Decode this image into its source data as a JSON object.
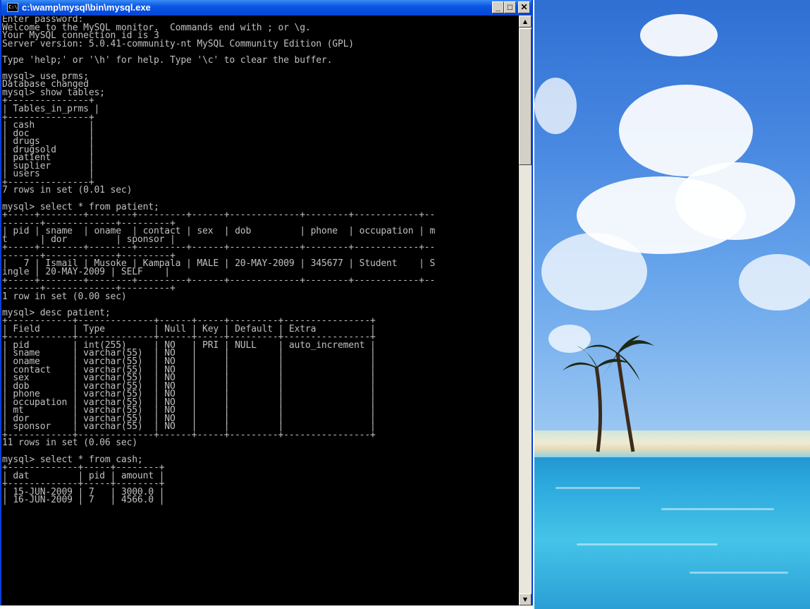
{
  "window": {
    "title": "c:\\wamp\\mysql\\bin\\mysql.exe",
    "icon_name": "console-icon",
    "icon_text": "C:\\",
    "buttons": {
      "minimize": "_",
      "maximize": "□",
      "close": "✕"
    }
  },
  "scrollbar": {
    "up_icon": "▲",
    "down_icon": "▼"
  },
  "console": {
    "lines": [
      "Enter password:",
      "Welcome to the MySQL monitor.  Commands end with ; or \\g.",
      "Your MySQL connection id is 3",
      "Server version: 5.0.41-community-nt MySQL Community Edition (GPL)",
      "",
      "Type 'help;' or '\\h' for help. Type '\\c' to clear the buffer.",
      "",
      "mysql> use prms;",
      "Database changed",
      "mysql> show tables;",
      "+---------------+",
      "| Tables_in_prms |",
      "+---------------+",
      "| cash          |",
      "| doc           |",
      "| drugs         |",
      "| drugsold      |",
      "| patient       |",
      "| suplier       |",
      "| users         |",
      "+---------------+",
      "7 rows in set (0.01 sec)",
      "",
      "mysql> select * from patient;",
      "+-----+--------+--------+---------+------+-------------+--------+------------+--",
      "-------+-------------+---------+",
      "| pid | sname  | oname  | contact | sex  | dob         | phone  | occupation | m",
      "t      | dor         | sponsor |",
      "+-----+--------+--------+---------+------+-------------+--------+------------+--",
      "-------+-------------+---------+",
      "|   7 | Ismail | Musoke | Kampala | MALE | 20-MAY-2009 | 345677 | Student    | S",
      "ingle | 20-MAY-2009 | SELF    |",
      "+-----+--------+--------+---------+------+-------------+--------+------------+--",
      "-------+-------------+---------+",
      "1 row in set (0.00 sec)",
      "",
      "mysql> desc patient;",
      "+------------+--------------+------+-----+---------+----------------+",
      "| Field      | Type         | Null | Key | Default | Extra          |",
      "+------------+--------------+------+-----+---------+----------------+",
      "| pid        | int(255)     | NO   | PRI | NULL    | auto_increment |",
      "| sname      | varchar(55)  | NO   |     |         |                |",
      "| oname      | varchar(55)  | NO   |     |         |                |",
      "| contact    | varchar(55)  | NO   |     |         |                |",
      "| sex        | varchar(55)  | NO   |     |         |                |",
      "| dob        | varchar(55)  | NO   |     |         |                |",
      "| phone      | varchar(55)  | NO   |     |         |                |",
      "| occupation | varchar(55)  | NO   |     |         |                |",
      "| mt         | varchar(55)  | NO   |     |         |                |",
      "| dor        | varchar(55)  | NO   |     |         |                |",
      "| sponsor    | varchar(55)  | NO   |     |         |                |",
      "+------------+--------------+------+-----+---------+----------------+",
      "11 rows in set (0.06 sec)",
      "",
      "mysql> select * from cash;",
      "+-------------+-----+--------+",
      "| dat         | pid | amount |",
      "+-------------+-----+--------+",
      "| 15-JUN-2009 | 7   | 3000.0 |",
      "| 16-JUN-2009 | 7   | 4566.0 |"
    ]
  }
}
